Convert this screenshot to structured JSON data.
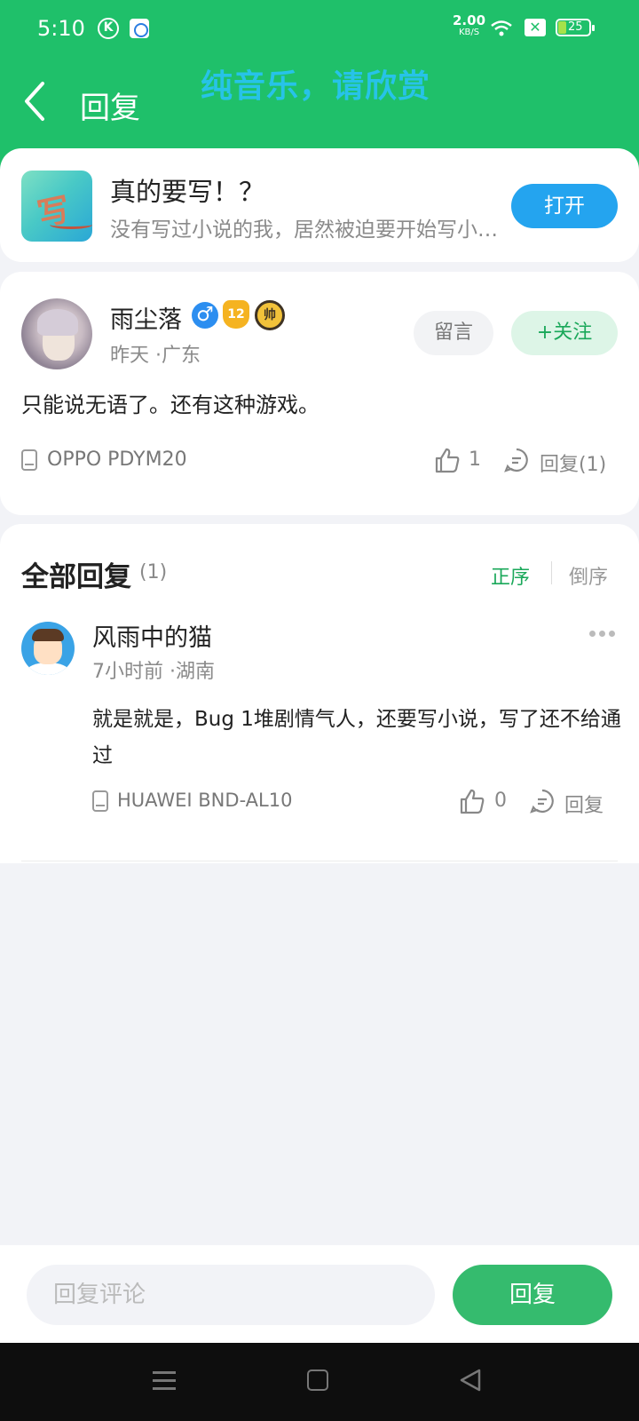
{
  "status_bar": {
    "time": "5:10",
    "k_icon": "K",
    "net_speed": "2.00",
    "net_unit": "KB/S",
    "close_badge": "✕",
    "battery": "25"
  },
  "header": {
    "back_icon": "chevron-left",
    "title": "回复",
    "overlay_text": "纯音乐，请欣赏"
  },
  "app_card": {
    "icon_char": "写",
    "title": "真的要写！？",
    "description": "没有写过小说的我，居然被迫要开始写小说了...",
    "open_label": "打开"
  },
  "comment": {
    "username": "雨尘落",
    "gender_icon": "♂",
    "level": "12",
    "badge": "帅",
    "meta": "昨天 ·广东",
    "message_label": "留言",
    "follow_label": "+关注",
    "text": "只能说无语了。还有这种游戏。",
    "device": "OPPO PDYM20",
    "likes": "1",
    "reply_label": "回复(1)"
  },
  "replies": {
    "heading": "全部回复",
    "count": "(1)",
    "sort_asc": "正序",
    "sort_desc": "倒序",
    "items": [
      {
        "username": "风雨中的猫",
        "meta": "7小时前 ·湖南",
        "text": "就是就是，Bug 1堆剧情气人，还要写小说，写了还不给通过",
        "device": "HUAWEI BND-AL10",
        "likes": "0",
        "reply_label": "回复"
      }
    ]
  },
  "bottom_bar": {
    "input_placeholder": "回复评论",
    "submit_label": "回复"
  },
  "colors": {
    "header": "#1fc06a",
    "accent": "#1aa85a",
    "open_button": "#24a4ef",
    "overlay_text": "#27c3e8"
  }
}
